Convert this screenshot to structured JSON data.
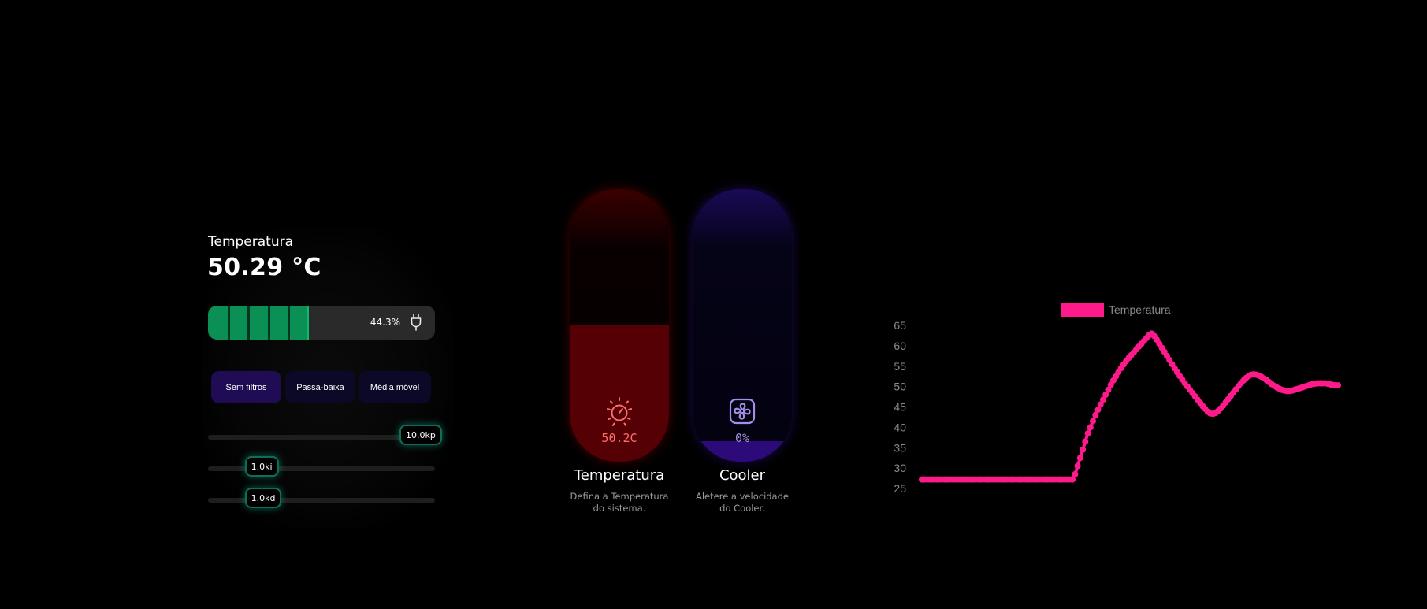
{
  "status": {
    "label": "Temperatura",
    "value": "50.29 °C"
  },
  "power": {
    "percent_label": "44.3%",
    "percent": 44.3,
    "segments": 5,
    "fill_color": "#0a8f55",
    "icon": "plug-icon"
  },
  "filters": {
    "options": [
      "Sem filtros",
      "Passa-baixa",
      "Média móvel"
    ],
    "selected": "Sem filtros"
  },
  "sliders": [
    {
      "label": "10.0kp",
      "value": 10.0,
      "max": 10.0
    },
    {
      "label": "1.0ki",
      "value": 1.0,
      "max": 10.0
    },
    {
      "label": "1.0kd",
      "value": 1.0,
      "max": 10.0
    }
  ],
  "capsules": {
    "temperature": {
      "reading": "50.2C",
      "title": "Temperatura",
      "desc_line1": "Defina a Temperatura",
      "desc_line2": "do sistema.",
      "level": 0.5,
      "icon": "thermostat-dial-icon",
      "color": "#550005"
    },
    "cooler": {
      "reading": "0%",
      "title": "Cooler",
      "desc_line1": "Aletere a velocidade",
      "desc_line2": "do Cooler.",
      "level": 0.0,
      "icon": "fan-icon",
      "color": "#2c0a7a"
    }
  },
  "chart_data": {
    "type": "line",
    "title": "",
    "xlabel": "",
    "ylabel": "",
    "ylim": [
      25,
      65
    ],
    "yticks": [
      65,
      60,
      55,
      50,
      45,
      40,
      35,
      30,
      25
    ],
    "grid": false,
    "legend_position": "top-center",
    "series": [
      {
        "name": "Temperatura",
        "color": "#ff1a8c",
        "values": [
          27.2,
          27.2,
          27.2,
          27.2,
          27.2,
          27.2,
          27.2,
          27.2,
          27.2,
          27.2,
          27.2,
          27.2,
          27.2,
          27.2,
          27.2,
          27.2,
          27.2,
          27.2,
          27.2,
          27.2,
          27.2,
          27.2,
          27.2,
          27.2,
          27.2,
          27.2,
          27.2,
          27.2,
          27.2,
          27.2,
          27.2,
          27.2,
          27.2,
          27.2,
          27.2,
          27.2,
          27.2,
          27.2,
          27.2,
          27.2,
          27.2,
          27.2,
          27.2,
          27.2,
          27.2,
          27.2,
          27.2,
          27.2,
          27.2,
          27.2,
          27.2,
          27.2,
          27.2,
          27.2,
          27.2,
          27.2,
          27.2,
          27.2,
          27.2,
          27.2,
          28.5,
          30.5,
          32.5,
          34.5,
          36.5,
          38.5,
          40.0,
          41.5,
          43.0,
          44.3,
          45.6,
          46.8,
          48.0,
          49.2,
          50.4,
          51.5,
          52.5,
          53.5,
          54.5,
          55.4,
          56.2,
          57.0,
          57.7,
          58.4,
          59.1,
          59.8,
          60.5,
          61.2,
          61.9,
          62.6,
          63.0,
          62.4,
          61.5,
          60.5,
          59.5,
          58.5,
          57.5,
          56.5,
          55.5,
          54.5,
          53.5,
          52.6,
          51.7,
          50.8,
          50.0,
          49.2,
          48.4,
          47.6,
          46.8,
          46.0,
          45.2,
          44.5,
          43.8,
          43.4,
          43.3,
          43.5,
          44.0,
          44.6,
          45.3,
          46.1,
          46.9,
          47.7,
          48.5,
          49.3,
          50.1,
          50.8,
          51.5,
          52.1,
          52.6,
          52.9,
          53.0,
          52.9,
          52.7,
          52.4,
          52.0,
          51.6,
          51.1,
          50.6,
          50.2,
          49.8,
          49.5,
          49.2,
          49.0,
          48.9,
          48.9,
          49.0,
          49.2,
          49.4,
          49.6,
          49.8,
          50.0,
          50.2,
          50.4,
          50.6,
          50.7,
          50.8,
          50.8,
          50.8,
          50.8,
          50.7,
          50.5,
          50.4,
          50.3,
          50.3
        ]
      }
    ]
  }
}
